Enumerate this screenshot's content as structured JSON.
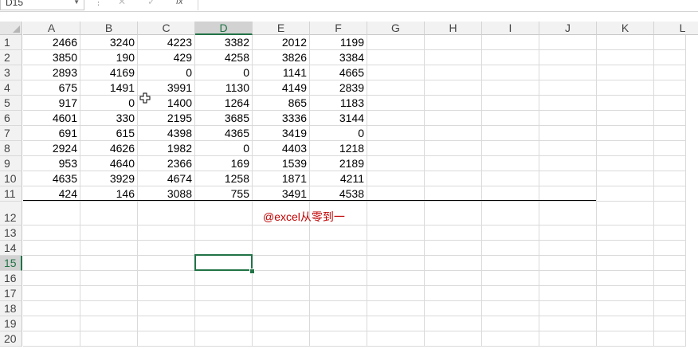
{
  "formula_bar": {
    "name_box": "D15",
    "cancel_icon": "✕",
    "enter_icon": "✓",
    "fx_label": "fx",
    "formula": ""
  },
  "columns": [
    "A",
    "B",
    "C",
    "D",
    "E",
    "F",
    "G",
    "H",
    "I",
    "J",
    "K",
    "L"
  ],
  "selected_column": "D",
  "selected_row": "15",
  "rows": [
    {
      "num": "1",
      "cells": [
        "2466",
        "3240",
        "4223",
        "3382",
        "2012",
        "1199"
      ]
    },
    {
      "num": "2",
      "cells": [
        "3850",
        "190",
        "429",
        "4258",
        "3826",
        "3384"
      ]
    },
    {
      "num": "3",
      "cells": [
        "2893",
        "4169",
        "0",
        "0",
        "1141",
        "4665"
      ]
    },
    {
      "num": "4",
      "cells": [
        "675",
        "1491",
        "3991",
        "1130",
        "4149",
        "2839"
      ]
    },
    {
      "num": "5",
      "cells": [
        "917",
        "0",
        "1400",
        "1264",
        "865",
        "1183"
      ]
    },
    {
      "num": "6",
      "cells": [
        "4601",
        "330",
        "2195",
        "3685",
        "3336",
        "3144"
      ]
    },
    {
      "num": "7",
      "cells": [
        "691",
        "615",
        "4398",
        "4365",
        "3419",
        "0"
      ]
    },
    {
      "num": "8",
      "cells": [
        "2924",
        "4626",
        "1982",
        "0",
        "4403",
        "1218"
      ]
    },
    {
      "num": "9",
      "cells": [
        "953",
        "4640",
        "2366",
        "169",
        "1539",
        "2189"
      ]
    },
    {
      "num": "10",
      "cells": [
        "4635",
        "3929",
        "4674",
        "1258",
        "1871",
        "4211"
      ]
    },
    {
      "num": "11",
      "cells": [
        "424",
        "146",
        "3088",
        "755",
        "3491",
        "4538"
      ]
    },
    {
      "num": "12",
      "cells": []
    },
    {
      "num": "13",
      "cells": []
    },
    {
      "num": "14",
      "cells": []
    },
    {
      "num": "15",
      "cells": []
    },
    {
      "num": "16",
      "cells": []
    },
    {
      "num": "17",
      "cells": []
    },
    {
      "num": "18",
      "cells": []
    },
    {
      "num": "19",
      "cells": []
    },
    {
      "num": "20",
      "cells": []
    }
  ],
  "caption": "@excel从零到一",
  "colors": {
    "accent": "#217346",
    "caption": "#c00000"
  }
}
